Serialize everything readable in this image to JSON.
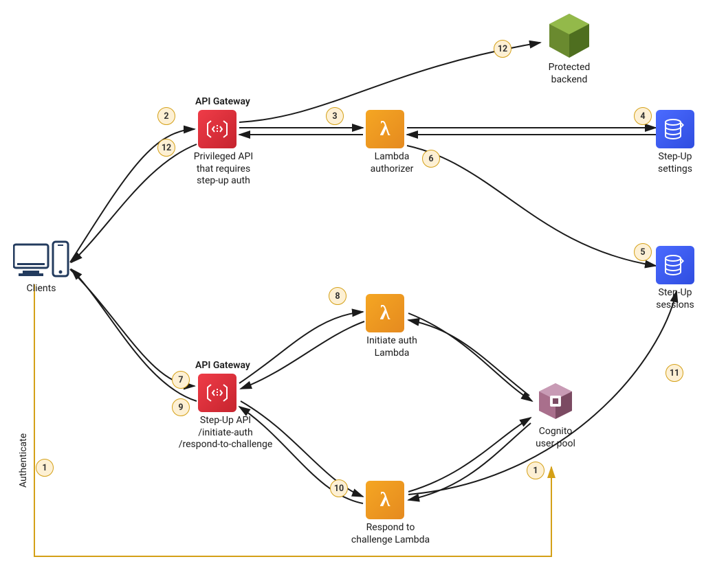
{
  "nodes": {
    "clients": "Clients",
    "protected": "Protected\nbackend",
    "apigw1_title": "API Gateway",
    "apigw1_label": "Privileged API\nthat requires\nstep-up auth",
    "apigw2_title": "API Gateway",
    "apigw2_label": "Step-Up API\n/initiate-auth\n/respond-to-challenge",
    "lambda_auth": "Lambda\nauthorizer",
    "lambda_init": "Initiate auth\nLambda",
    "lambda_resp": "Respond to\nchallenge Lambda",
    "stepup_settings": "Step-Up\nsettings",
    "stepup_sessions": "Step-Up\nsessions",
    "cognito": "Cognito\nuser pool"
  },
  "authenticate": "Authenticate",
  "badges": {
    "b1": "1",
    "b2": "2",
    "b3": "3",
    "b4": "4",
    "b5": "5",
    "b6": "6",
    "b7": "7",
    "b8": "8",
    "b9": "9",
    "b10": "10",
    "b11": "11",
    "b12a": "12",
    "b12b": "12",
    "b1b": "1"
  },
  "colors": {
    "orange": "#d4a017",
    "black": "#1b1b1b"
  }
}
